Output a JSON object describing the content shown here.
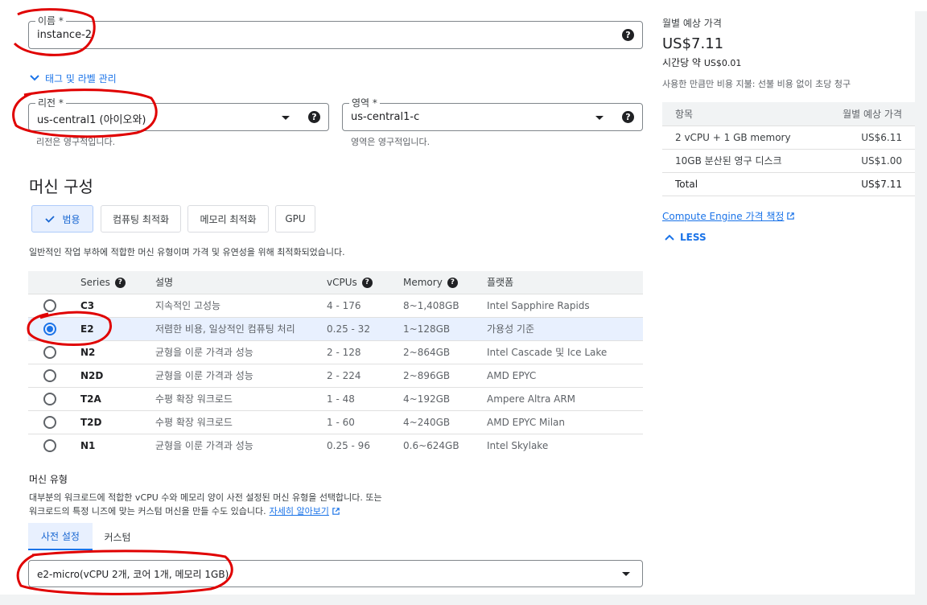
{
  "name_field": {
    "label": "이름 *",
    "value": "instance-2"
  },
  "tags_toggle": {
    "label": "태그 및 라벨 관리"
  },
  "region_field": {
    "label": "리전 *",
    "value": "us-central1 (아이오와)",
    "hint": "리전은 영구적입니다."
  },
  "zone_field": {
    "label": "영역 *",
    "value": "us-central1-c",
    "hint": "영역은 영구적입니다."
  },
  "machine_config": {
    "title": "머신 구성",
    "chips": [
      {
        "label": "범용",
        "active": true
      },
      {
        "label": "컴퓨팅 최적화"
      },
      {
        "label": "메모리 최적화"
      },
      {
        "label": "GPU"
      }
    ],
    "description": "일반적인 작업 부하에 적합한 머신 유형이며 가격 및 유연성을 위해 최적화되었습니다."
  },
  "series_table": {
    "headers": [
      "Series",
      "설명",
      "vCPUs",
      "Memory",
      "플랫폼"
    ],
    "rows": [
      {
        "series": "C3",
        "desc": "지속적인 고성능",
        "vcpus": "4 - 176",
        "memory": "8~1,408GB",
        "platform": "Intel Sapphire Rapids"
      },
      {
        "series": "E2",
        "desc": "저렴한 비용, 일상적인 컴퓨팅 처리",
        "vcpus": "0.25 - 32",
        "memory": "1~128GB",
        "platform": "가용성 기준",
        "selected": true
      },
      {
        "series": "N2",
        "desc": "균형을 이룬 가격과 성능",
        "vcpus": "2 - 128",
        "memory": "2~864GB",
        "platform": "Intel Cascade 및 Ice Lake"
      },
      {
        "series": "N2D",
        "desc": "균형을 이룬 가격과 성능",
        "vcpus": "2 - 224",
        "memory": "2~896GB",
        "platform": "AMD EPYC"
      },
      {
        "series": "T2A",
        "desc": "수평 확장 워크로드",
        "vcpus": "1 - 48",
        "memory": "4~192GB",
        "platform": "Ampere Altra ARM"
      },
      {
        "series": "T2D",
        "desc": "수평 확장 워크로드",
        "vcpus": "1 - 60",
        "memory": "4~240GB",
        "platform": "AMD EPYC Milan"
      },
      {
        "series": "N1",
        "desc": "균형을 이룬 가격과 성능",
        "vcpus": "0.25 - 96",
        "memory": "0.6~624GB",
        "platform": "Intel Skylake"
      }
    ]
  },
  "machine_type": {
    "title": "머신 유형",
    "desc1": "대부분의 워크로드에 적합한 vCPU 수와 메모리 양이 사전 설정된 머신 유형을 선택합니다. 또는",
    "desc2": "워크로드의 특정 니즈에 맞는 커스텀 머신을 만들 수도 있습니다.",
    "learn_more": "자세히 알아보기",
    "tabs": [
      {
        "label": "사전 설정",
        "active": true
      },
      {
        "label": "커스텀"
      }
    ],
    "select_value": "e2-micro(vCPU 2개, 코어 1개, 메모리 1GB)"
  },
  "pricing": {
    "heading": "월별 예상 가격",
    "monthly": "US$7.11",
    "hourly_prefix": "시간당 약",
    "hourly_value": "US$0.01",
    "note": "사용한 만큼만 비용 지불: 선불 비용 없이 초당 청구",
    "table_headers": [
      "항목",
      "월별 예상 가격"
    ],
    "rows": [
      {
        "item": "2 vCPU + 1 GB memory",
        "price": "US$6.11"
      },
      {
        "item": "10GB 분산된 영구 디스크",
        "price": "US$1.00"
      }
    ],
    "total": {
      "item": "Total",
      "price": "US$7.11"
    },
    "compute_link": "Compute Engine 가격 책정",
    "less_label": "LESS"
  },
  "colors": {
    "accent": "#1a73e8",
    "annotation": "#e00000",
    "selected_row": "#e8f0fe"
  }
}
